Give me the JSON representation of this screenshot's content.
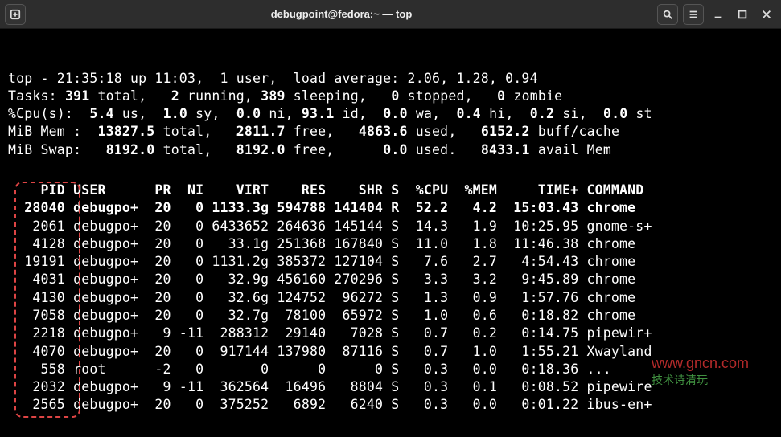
{
  "window": {
    "title": "debugpoint@fedora:~ — top"
  },
  "summary": {
    "line1": "top - 21:35:18 up 11:03,  1 user,  load average: 2.06, 1.28, 0.94",
    "tasks_label": "Tasks:",
    "tasks_total": "391",
    "tasks_total_lbl": "total,",
    "tasks_running": "2",
    "tasks_running_lbl": "running,",
    "tasks_sleeping": "389",
    "tasks_sleeping_lbl": "sleeping,",
    "tasks_stopped": "0",
    "tasks_stopped_lbl": "stopped,",
    "tasks_zombie": "0",
    "tasks_zombie_lbl": "zombie",
    "cpu_label": "%Cpu(s):",
    "cpu_us": "5.4",
    "cpu_us_lbl": "us,",
    "cpu_sy": "1.0",
    "cpu_sy_lbl": "sy,",
    "cpu_ni": "0.0",
    "cpu_ni_lbl": "ni,",
    "cpu_id": "93.1",
    "cpu_id_lbl": "id,",
    "cpu_wa": "0.0",
    "cpu_wa_lbl": "wa,",
    "cpu_hi": "0.4",
    "cpu_hi_lbl": "hi,",
    "cpu_si": "0.2",
    "cpu_si_lbl": "si,",
    "cpu_st": "0.0",
    "cpu_st_lbl": "st",
    "mem_label": "MiB Mem :",
    "mem_total": "13827.5",
    "mem_total_lbl": "total,",
    "mem_free": "2811.7",
    "mem_free_lbl": "free,",
    "mem_used": "4863.6",
    "mem_used_lbl": "used,",
    "mem_buff": "6152.2",
    "mem_buff_lbl": "buff/cache",
    "swap_label": "MiB Swap:",
    "swap_total": "8192.0",
    "swap_total_lbl": "total,",
    "swap_free": "8192.0",
    "swap_free_lbl": "free,",
    "swap_used": "0.0",
    "swap_used_lbl": "used.",
    "swap_avail": "8433.1",
    "swap_avail_lbl": "avail Mem"
  },
  "headers": "    PID USER      PR  NI    VIRT    RES    SHR S  %CPU  %MEM     TIME+ COMMAND  ",
  "rows": [
    {
      "hl": true,
      "txt": "  28040 debugpo+  20   0 1133.3g 594788 141404 R  52.2   4.2  15:03.43 chrome   "
    },
    {
      "hl": false,
      "txt": "   2061 debugpo+  20   0 6433652 264636 145144 S  14.3   1.9  10:25.95 gnome-s+ "
    },
    {
      "hl": false,
      "txt": "   4128 debugpo+  20   0   33.1g 251368 167840 S  11.0   1.8  11:46.38 chrome   "
    },
    {
      "hl": false,
      "txt": "  19191 debugpo+  20   0 1131.2g 385372 127104 S   7.6   2.7   4:54.43 chrome   "
    },
    {
      "hl": false,
      "txt": "   4031 debugpo+  20   0   32.9g 456160 270296 S   3.3   3.2   9:45.89 chrome   "
    },
    {
      "hl": false,
      "txt": "   4130 debugpo+  20   0   32.6g 124752  96272 S   1.3   0.9   1:57.76 chrome   "
    },
    {
      "hl": false,
      "txt": "   7058 debugpo+  20   0   32.7g  78100  65972 S   1.0   0.6   0:18.82 chrome   "
    },
    {
      "hl": false,
      "txt": "   2218 debugpo+   9 -11  288312  29140   7028 S   0.7   0.2   0:14.75 pipewir+ "
    },
    {
      "hl": false,
      "txt": "   4070 debugpo+  20   0  917144 137980  87116 S   0.7   1.0   1:55.21 Xwayland "
    },
    {
      "hl": false,
      "txt": "    558 root      -2   0       0      0      0 S   0.3   0.0   0:18.36 ...      "
    },
    {
      "hl": false,
      "txt": "   2032 debugpo+   9 -11  362564  16496   8804 S   0.3   0.1   0:08.52 pipewire "
    },
    {
      "hl": false,
      "txt": "   2565 debugpo+  20   0  375252   6892   6240 S   0.3   0.0   0:01.22 ibus-en+ "
    }
  ],
  "watermark": {
    "line1": "www.gncn.com",
    "line2": "技术诗清玩"
  }
}
